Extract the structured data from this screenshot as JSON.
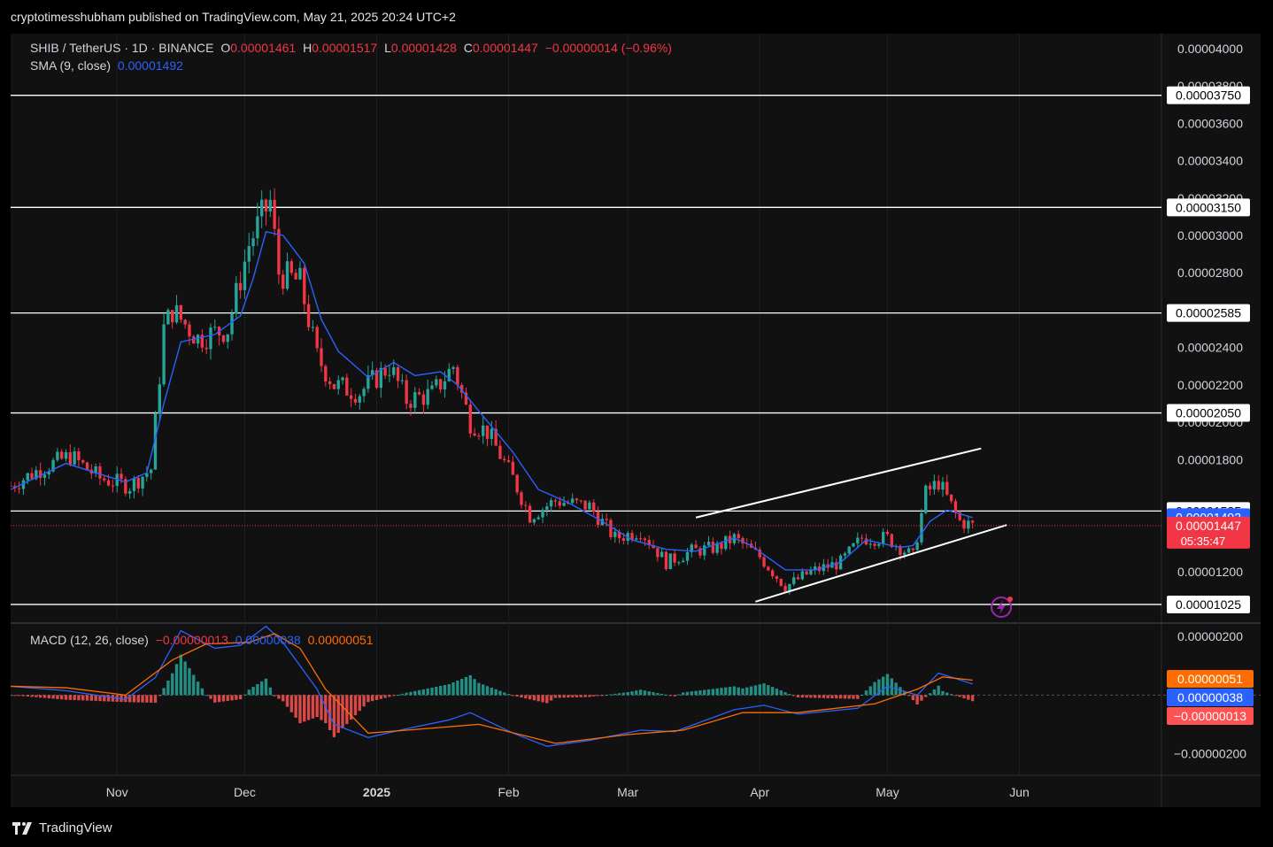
{
  "header": {
    "publisher": "cryptotimesshubham published on TradingView.com, May 21, 2025 20:24 UTC+2"
  },
  "legend": {
    "symbol": "SHIB / TetherUS · 1D · BINANCE",
    "o_label": "O",
    "o": "0.00001461",
    "h_label": "H",
    "h": "0.00001517",
    "l_label": "L",
    "l": "0.00001428",
    "c_label": "C",
    "c": "0.00001447",
    "change": "−0.00000014 (−0.96%)",
    "sma_label": "SMA (9, close)",
    "sma": "0.00001492",
    "macd_label": "MACD (12, 26, close)",
    "macd_hist": "−0.00000013",
    "macd_line": "0.00000038",
    "macd_signal": "0.00000051"
  },
  "footer": {
    "brand": "TradingView"
  },
  "colors": {
    "up": "#26a69a",
    "down": "#f23645",
    "sma": "#2962ff",
    "macd": "#2962ff",
    "signal": "#ff6d00",
    "level": "#ffffff"
  },
  "icons": [
    "tradingview-logo-icon",
    "lightning-icon"
  ],
  "chart_data": {
    "type": "candlestick",
    "price_axis": {
      "ticks": [
        "0.00004000",
        "0.00003800",
        "0.00003600",
        "0.00003400",
        "0.00003200",
        "0.00003000",
        "0.00002800",
        "0.00002600",
        "0.00002400",
        "0.00002200",
        "0.00002000",
        "0.00001800",
        "0.00001200"
      ],
      "ylim": [
        9.3e-06,
        4.08e-05
      ]
    },
    "time_axis": {
      "ticks": [
        "Nov",
        "Dec",
        "2025",
        "Feb",
        "Mar",
        "Apr",
        "May",
        "Jun"
      ]
    },
    "horizontal_levels": [
      "0.00003750",
      "0.00003150",
      "0.00002585",
      "0.00002050",
      "0.00001525",
      "0.00001025"
    ],
    "current_sma_label": "0.00001492",
    "current_price_label": "0.00001447",
    "countdown": "05:35:47",
    "channel": {
      "upper": [
        [
          "2025-03-17",
          1.49e-05
        ],
        [
          "2025-05-23",
          1.86e-05
        ]
      ],
      "lower": [
        [
          "2025-03-31",
          1.04e-05
        ],
        [
          "2025-05-29",
          1.45e-05
        ]
      ]
    },
    "sma": [
      [
        "2024-10-07",
        1.64e-05
      ],
      [
        "2024-10-20",
        1.78e-05
      ],
      [
        "2024-11-03",
        1.68e-05
      ],
      [
        "2024-11-08",
        1.73e-05
      ],
      [
        "2024-11-12",
        2.1e-05
      ],
      [
        "2024-11-16",
        2.43e-05
      ],
      [
        "2024-11-24",
        2.47e-05
      ],
      [
        "2024-11-30",
        2.57e-05
      ],
      [
        "2024-12-03",
        2.77e-05
      ],
      [
        "2024-12-06",
        3.02e-05
      ],
      [
        "2024-12-10",
        3e-05
      ],
      [
        "2024-12-15",
        2.85e-05
      ],
      [
        "2024-12-19",
        2.55e-05
      ],
      [
        "2024-12-23",
        2.38e-05
      ],
      [
        "2024-12-30",
        2.24e-05
      ],
      [
        "2025-01-05",
        2.32e-05
      ],
      [
        "2025-01-10",
        2.25e-05
      ],
      [
        "2025-01-16",
        2.27e-05
      ],
      [
        "2025-01-20",
        2.2e-05
      ],
      [
        "2025-01-25",
        2.06e-05
      ],
      [
        "2025-02-02",
        1.84e-05
      ],
      [
        "2025-02-08",
        1.64e-05
      ],
      [
        "2025-02-15",
        1.57e-05
      ],
      [
        "2025-02-23",
        1.47e-05
      ],
      [
        "2025-03-02",
        1.37e-05
      ],
      [
        "2025-03-10",
        1.32e-05
      ],
      [
        "2025-03-17",
        1.31e-05
      ],
      [
        "2025-03-26",
        1.38e-05
      ],
      [
        "2025-03-30",
        1.34e-05
      ],
      [
        "2025-04-07",
        1.21e-05
      ],
      [
        "2025-04-14",
        1.21e-05
      ],
      [
        "2025-04-20",
        1.25e-05
      ],
      [
        "2025-04-26",
        1.37e-05
      ],
      [
        "2025-05-04",
        1.33e-05
      ],
      [
        "2025-05-07",
        1.34e-05
      ],
      [
        "2025-05-11",
        1.47e-05
      ],
      [
        "2025-05-15",
        1.53e-05
      ],
      [
        "2025-05-21",
        1.49e-05
      ]
    ],
    "candles_note": "daily OHLC candles, approximate path",
    "candle_path": [
      [
        "2024-10-07",
        1.66e-05
      ],
      [
        "2024-10-14",
        1.75e-05
      ],
      [
        "2024-10-21",
        1.82e-05
      ],
      [
        "2024-10-28",
        1.7e-05
      ],
      [
        "2024-11-04",
        1.66e-05
      ],
      [
        "2024-11-09",
        1.75e-05
      ],
      [
        "2024-11-12",
        2.5e-05
      ],
      [
        "2024-11-14",
        2.6e-05
      ],
      [
        "2024-11-20",
        2.45e-05
      ],
      [
        "2024-11-27",
        2.5e-05
      ],
      [
        "2024-12-02",
        2.95e-05
      ],
      [
        "2024-12-05",
        3.1e-05
      ],
      [
        "2024-12-07",
        3.18e-05
      ],
      [
        "2024-12-09",
        2.8e-05
      ],
      [
        "2024-12-14",
        2.75e-05
      ],
      [
        "2024-12-18",
        2.35e-05
      ],
      [
        "2024-12-22",
        2.2e-05
      ],
      [
        "2024-12-28",
        2.16e-05
      ],
      [
        "2025-01-04",
        2.3e-05
      ],
      [
        "2025-01-08",
        2.12e-05
      ],
      [
        "2025-01-14",
        2.15e-05
      ],
      [
        "2025-01-19",
        2.3e-05
      ],
      [
        "2025-01-23",
        2e-05
      ],
      [
        "2025-01-27",
        1.95e-05
      ],
      [
        "2025-02-02",
        1.7e-05
      ],
      [
        "2025-02-06",
        1.5e-05
      ],
      [
        "2025-02-12",
        1.58e-05
      ],
      [
        "2025-02-20",
        1.55e-05
      ],
      [
        "2025-02-26",
        1.38e-05
      ],
      [
        "2025-03-04",
        1.42e-05
      ],
      [
        "2025-03-10",
        1.25e-05
      ],
      [
        "2025-03-16",
        1.31e-05
      ],
      [
        "2025-03-22",
        1.33e-05
      ],
      [
        "2025-03-26",
        1.38e-05
      ],
      [
        "2025-04-01",
        1.28e-05
      ],
      [
        "2025-04-07",
        1.12e-05
      ],
      [
        "2025-04-13",
        1.2e-05
      ],
      [
        "2025-04-20",
        1.25e-05
      ],
      [
        "2025-04-25",
        1.38e-05
      ],
      [
        "2025-05-01",
        1.38e-05
      ],
      [
        "2025-05-07",
        1.28e-05
      ],
      [
        "2025-05-10",
        1.62e-05
      ],
      [
        "2025-05-13",
        1.68e-05
      ],
      [
        "2025-05-18",
        1.47e-05
      ],
      [
        "2025-05-21",
        1.447e-05
      ]
    ],
    "macd_axis": {
      "ticks": [
        "0.00000200",
        "−0.00000200"
      ],
      "ylim": [
        -2.5e-06,
        2.4e-06
      ]
    },
    "macd_labels": [
      "0.00000051",
      "0.00000038",
      "−0.00000013"
    ],
    "macd": [
      [
        "2024-10-07",
        3e-07
      ],
      [
        "2024-10-20",
        1.5e-07
      ],
      [
        "2024-11-03",
        -1.5e-07
      ],
      [
        "2024-11-10",
        6e-07
      ],
      [
        "2024-11-16",
        2.2e-06
      ],
      [
        "2024-11-24",
        1.6e-06
      ],
      [
        "2024-11-30",
        1.7e-06
      ],
      [
        "2024-12-06",
        2.35e-06
      ],
      [
        "2024-12-10",
        1.8e-06
      ],
      [
        "2024-12-18",
        2e-07
      ],
      [
        "2024-12-22",
        -1e-06
      ],
      [
        "2024-12-30",
        -1.45e-06
      ],
      [
        "2025-01-08",
        -1.15e-06
      ],
      [
        "2025-01-18",
        -8.5e-07
      ],
      [
        "2025-01-23",
        -6e-07
      ],
      [
        "2025-02-02",
        -1.3e-06
      ],
      [
        "2025-02-10",
        -1.75e-06
      ],
      [
        "2025-02-20",
        -1.55e-06
      ],
      [
        "2025-03-04",
        -1.2e-06
      ],
      [
        "2025-03-12",
        -1.25e-06
      ],
      [
        "2025-03-26",
        -5e-07
      ],
      [
        "2025-04-02",
        -3.5e-07
      ],
      [
        "2025-04-10",
        -6.5e-07
      ],
      [
        "2025-04-24",
        -4.5e-07
      ],
      [
        "2025-05-01",
        3e-07
      ],
      [
        "2025-05-08",
        0.0
      ],
      [
        "2025-05-13",
        7.5e-07
      ],
      [
        "2025-05-21",
        3.8e-07
      ]
    ],
    "signal": [
      [
        "2024-10-07",
        3e-07
      ],
      [
        "2024-10-20",
        2.5e-07
      ],
      [
        "2024-11-03",
        0.0
      ],
      [
        "2024-11-14",
        1.2e-06
      ],
      [
        "2024-11-22",
        1.75e-06
      ],
      [
        "2024-12-02",
        1.8e-06
      ],
      [
        "2024-12-08",
        2.1e-06
      ],
      [
        "2024-12-14",
        1.6e-06
      ],
      [
        "2024-12-20",
        2e-07
      ],
      [
        "2024-12-30",
        -1.3e-06
      ],
      [
        "2025-01-08",
        -1.2e-06
      ],
      [
        "2025-01-25",
        -1e-06
      ],
      [
        "2025-02-12",
        -1.65e-06
      ],
      [
        "2025-03-01",
        -1.35e-06
      ],
      [
        "2025-03-14",
        -1.2e-06
      ],
      [
        "2025-03-28",
        -6e-07
      ],
      [
        "2025-04-10",
        -6e-07
      ],
      [
        "2025-04-28",
        -3e-07
      ],
      [
        "2025-05-08",
        2e-07
      ],
      [
        "2025-05-14",
        6.2e-07
      ],
      [
        "2025-05-21",
        5.1e-07
      ]
    ]
  }
}
